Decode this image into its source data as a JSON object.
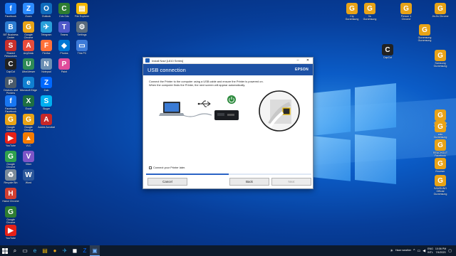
{
  "desktop": {
    "left_icons": [
      {
        "label": "Facebook",
        "color": "#1877f2",
        "glyph": "f"
      },
      {
        "label": "BIT Business Center",
        "color": "#2d7dd2",
        "glyph": "B"
      },
      {
        "label": "Shared Resources",
        "color": "#c9302c",
        "glyph": "S"
      },
      {
        "label": "CapCut",
        "color": "#222222",
        "glyph": "C"
      },
      {
        "label": "Devices and Printers",
        "color": "#4a5a6a",
        "glyph": "P"
      },
      {
        "label": "Facebook Facebook",
        "color": "#1877f2",
        "glyph": "f"
      },
      {
        "label": "Google Chrome",
        "color": "#e8a317",
        "glyph": "G"
      },
      {
        "label": "YouTube",
        "color": "#e62117",
        "glyph": "▶"
      },
      {
        "label": "Google Chrome",
        "color": "#30a14e",
        "glyph": "G"
      },
      {
        "label": "Recycle Bin",
        "color": "#7b8a99",
        "glyph": "♻"
      },
      {
        "label": "Hanoi Chrome",
        "color": "#d23f31",
        "glyph": "H"
      },
      {
        "label": "Google Chrome",
        "color": "#2e7d32",
        "glyph": "G"
      },
      {
        "label": "YouTube",
        "color": "#e62117",
        "glyph": "▶"
      },
      {
        "label": "Zoom",
        "color": "#2d8cff",
        "glyph": "Z"
      },
      {
        "label": "Google Chrome",
        "color": "#e8a317",
        "glyph": "G"
      },
      {
        "label": "AnyDesk",
        "color": "#e74c3c",
        "glyph": "A"
      },
      {
        "label": "UltraViewer",
        "color": "#2e8b57",
        "glyph": "U"
      },
      {
        "label": "Microsoft Edge",
        "color": "#0f7fd0",
        "glyph": "e"
      },
      {
        "label": "Excel",
        "color": "#1d6f42",
        "glyph": "X"
      },
      {
        "label": "Google Chrome",
        "color": "#e8a317",
        "glyph": "G"
      },
      {
        "label": "VLC",
        "color": "#f57c00",
        "glyph": "▲"
      },
      {
        "label": "Viber",
        "color": "#7d55c7",
        "glyph": "V"
      },
      {
        "label": "Word",
        "color": "#2b579a",
        "glyph": "W"
      },
      {
        "label": "Outlook",
        "color": "#0f6cbd",
        "glyph": "O"
      },
      {
        "label": "Telegram",
        "color": "#2aa0da",
        "glyph": "✈"
      },
      {
        "label": "Firefox",
        "color": "#ff7139",
        "glyph": "F"
      },
      {
        "label": "Notepad",
        "color": "#6b8fb3",
        "glyph": "N"
      },
      {
        "label": "Zalo",
        "color": "#0068ff",
        "glyph": "Z"
      },
      {
        "label": "Skype",
        "color": "#00aff0",
        "glyph": "S"
      },
      {
        "label": "Adobe Acrobat",
        "color": "#c62828",
        "glyph": "A"
      },
      {
        "label": "Cốc Cốc",
        "color": "#2e7d32",
        "glyph": "C"
      },
      {
        "label": "Teams",
        "color": "#5059c9",
        "glyph": "T"
      },
      {
        "label": "Photos",
        "color": "#0078d4",
        "glyph": "◆"
      },
      {
        "label": "Paint",
        "color": "#e04b9b",
        "glyph": "P"
      },
      {
        "label": "File Explorer",
        "color": "#f2b705",
        "glyph": "▤"
      },
      {
        "label": "Settings",
        "color": "#5a6b7c",
        "glyph": "⚙"
      },
      {
        "label": "This PC",
        "color": "#3d7bd9",
        "glyph": "▭"
      }
    ],
    "right_icons": [
      {
        "label": "Cty Guramsung",
        "color": "#e8a317",
        "glyph": "G"
      },
      {
        "label": "Vu Guramsung",
        "color": "#e8a317",
        "glyph": "G"
      },
      {
        "label": "Person 1 Chrome",
        "color": "#e8a317",
        "glyph": "G"
      },
      {
        "label": "JinJin Chrome",
        "color": "#e8a317",
        "glyph": "G"
      },
      {
        "label": "Guramsung Guramsung",
        "color": "#e8a317",
        "glyph": "G"
      },
      {
        "label": "CapCut",
        "color": "#222222",
        "glyph": "C"
      },
      {
        "label": "Samsung Guramsung",
        "color": "#e8a317",
        "glyph": "G"
      },
      {
        "label": "Guramsung Guramsung",
        "color": "#e8a317",
        "glyph": "G"
      },
      {
        "label": "zalo Guramsung",
        "color": "#e8a317",
        "glyph": "G"
      },
      {
        "label": "REACHOUT Facebook",
        "color": "#e8a317",
        "glyph": "G"
      },
      {
        "label": "Browser",
        "color": "#e8a317",
        "glyph": "G"
      },
      {
        "label": "SAMSUNG Official Guramsung",
        "color": "#e8a317",
        "glyph": "G"
      }
    ]
  },
  "window": {
    "title": "Install Navi [L810 Series]",
    "header": "USB connection",
    "brand": "EPSON",
    "instruction_line1": "Connect the Printer to the computer using a USB cable and ensure the Printer is powered on.",
    "instruction_line2": "When the computer finds the Printer, the next screen will appear automatically.",
    "checkbox_label": "Connect your Printer later.",
    "progress": 0.5,
    "cancel": "Cancel",
    "back": "Back",
    "next": "Next",
    "header_color": "#1d51a5"
  },
  "taskbar": {
    "weather": "Haze weather",
    "lang1": "ENG",
    "lang2": "INTL",
    "time": "10:06 PM",
    "date": "7/4/2023"
  }
}
